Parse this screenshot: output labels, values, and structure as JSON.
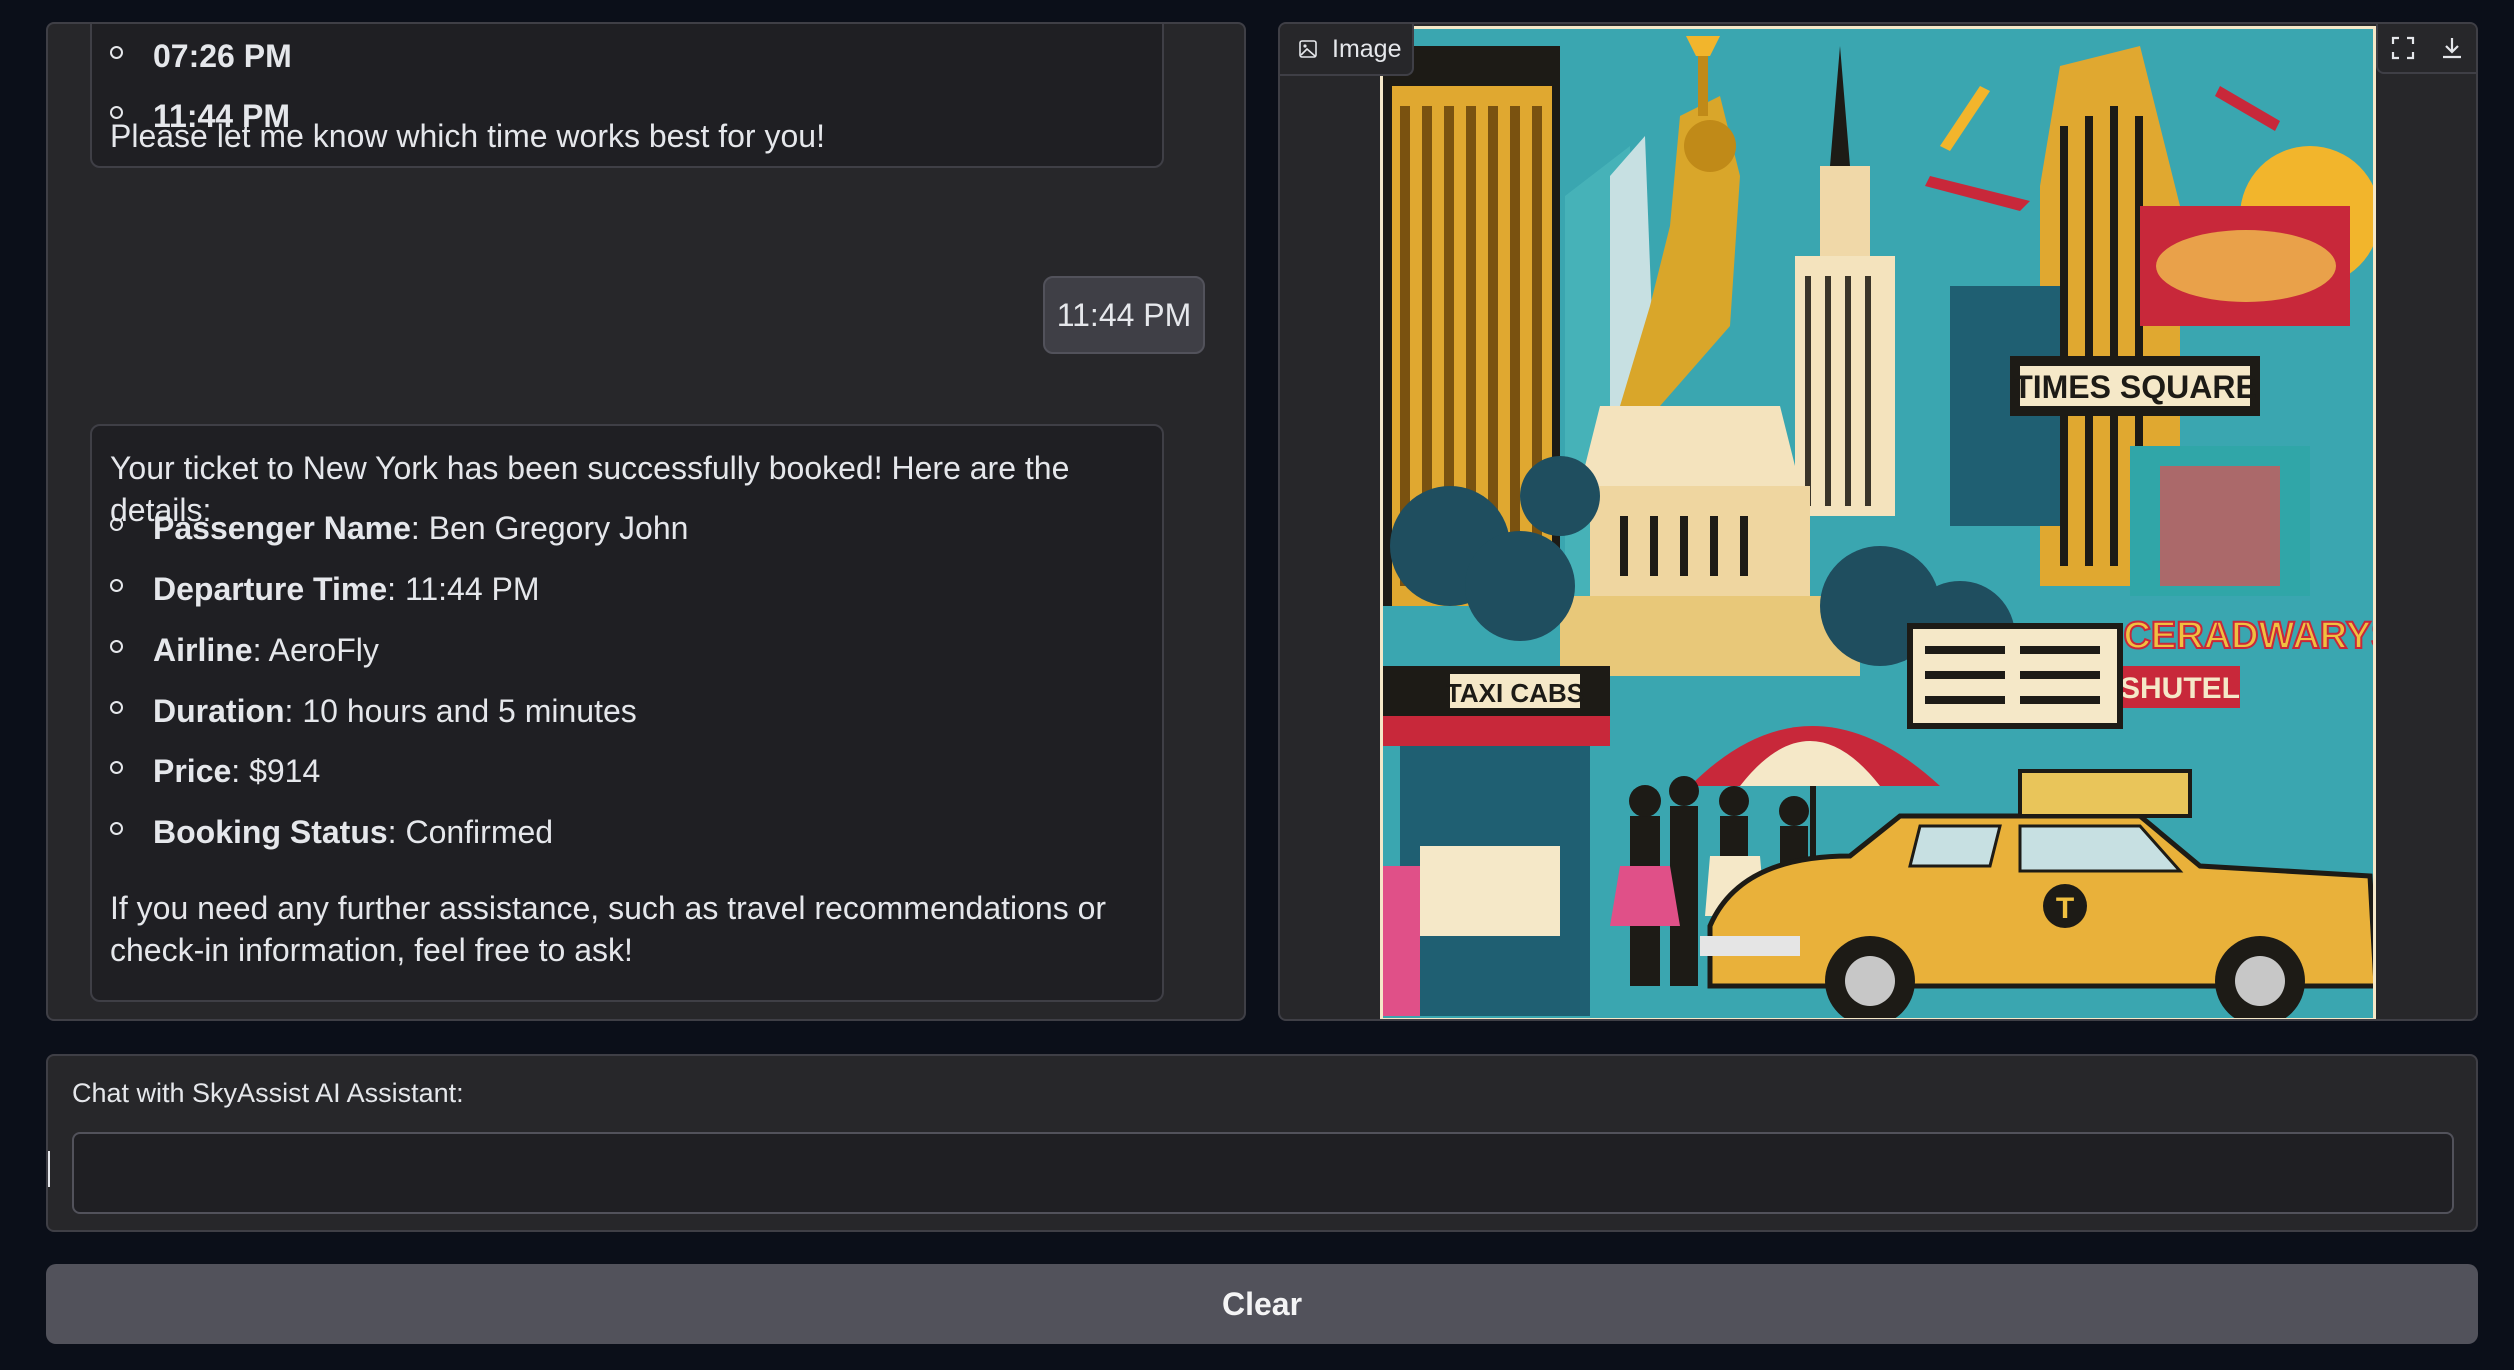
{
  "chat": {
    "msg1": {
      "items": [
        "07:26 PM",
        "11:44 PM"
      ],
      "closing": "Please let me know which time works best for you!"
    },
    "user_msg": "11:44 PM",
    "msg2": {
      "intro": "Your ticket to New York has been successfully booked! Here are the details:",
      "details": [
        {
          "label": "Passenger Name",
          "value": ": Ben Gregory John"
        },
        {
          "label": "Departure Time",
          "value": ": 11:44 PM"
        },
        {
          "label": "Airline",
          "value": ": AeroFly"
        },
        {
          "label": "Duration",
          "value": ": 10 hours and 5 minutes"
        },
        {
          "label": "Price",
          "value": ": $914"
        },
        {
          "label": "Booking Status",
          "value": ": Confirmed"
        }
      ],
      "closing": "If you need any further assistance, such as travel recommendations or check-in information, feel free to ask!"
    }
  },
  "image_panel": {
    "label": "Image",
    "label_icon": "image-icon",
    "tools": [
      "fullscreen-icon",
      "download-icon"
    ],
    "signs": {
      "taxi_cabs": "TAXI CABS",
      "times_square": "TIMES SQUARE",
      "broadway": "CERADWARYS",
      "hotel": "SHUTEL",
      "taxi_logo": "T"
    }
  },
  "input": {
    "label": "Chat with SkyAssist AI Assistant:",
    "value": "",
    "placeholder": ""
  },
  "clear_label": "Clear",
  "colors": {
    "background": "#0b0f19",
    "panel": "#27272a",
    "border": "#3f3f46",
    "button": "#52525b"
  }
}
